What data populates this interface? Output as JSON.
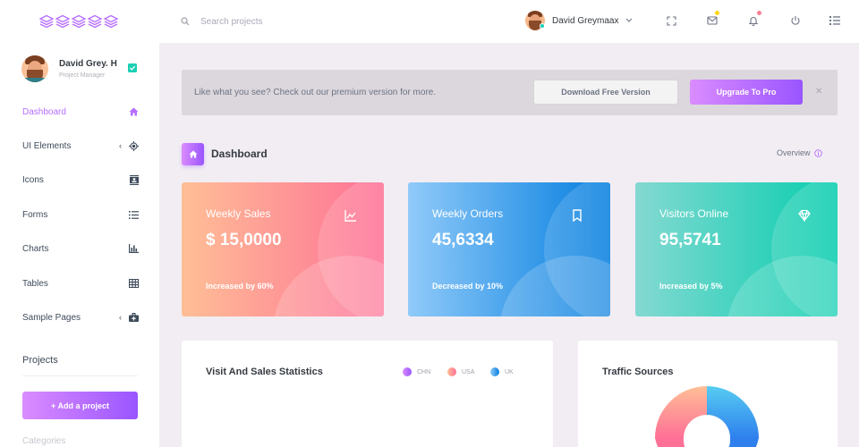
{
  "colors": {
    "accent": "#b66dff",
    "accent_gradient_start": "#da8cff",
    "accent_gradient_end": "#9a55ff",
    "sales_card_start": "#ffbf96",
    "sales_card_end": "#fe7096",
    "orders_card_start": "#90caf9",
    "orders_card_end": "#047edf",
    "visitors_card_start": "#84d9d2",
    "visitors_card_end": "#07cdae",
    "online_dot": "#1bcfb4"
  },
  "topbar": {
    "logo_icon": "stacked-layers-logo",
    "search_icon": "search-icon",
    "search_placeholder": "Search projects",
    "profile_name": "David Greymaax",
    "icons": [
      "fullscreen-icon",
      "mail-icon",
      "bell-icon",
      "power-icon",
      "menu-list-icon"
    ]
  },
  "sidebar": {
    "user": {
      "name": "David Grey. H",
      "role": "Project Manager"
    },
    "items": [
      {
        "label": "Dashboard",
        "icon": "home-icon",
        "chevron": false,
        "active": true
      },
      {
        "label": "UI Elements",
        "icon": "crosshair-icon",
        "chevron": true,
        "active": false
      },
      {
        "label": "Icons",
        "icon": "contacts-icon",
        "chevron": false,
        "active": false
      },
      {
        "label": "Forms",
        "icon": "list-icon",
        "chevron": false,
        "active": false
      },
      {
        "label": "Charts",
        "icon": "bar-chart-icon",
        "chevron": false,
        "active": false
      },
      {
        "label": "Tables",
        "icon": "table-icon",
        "chevron": false,
        "active": false
      },
      {
        "label": "Sample Pages",
        "icon": "medical-bag-icon",
        "chevron": true,
        "active": false
      }
    ],
    "projects_title": "Projects",
    "add_project_label": "+ Add a project",
    "categories_label": "Categories"
  },
  "banner": {
    "text": "Like what you see? Check out our premium version for more.",
    "download_label": "Download Free Version",
    "upgrade_label": "Upgrade To Pro",
    "close_label": "✕"
  },
  "page": {
    "title": "Dashboard",
    "overview_label": "Overview"
  },
  "stats": [
    {
      "title": "Weekly Sales",
      "value": "$ 15,0000",
      "footer": "Increased by 60%",
      "icon": "chart-line-icon"
    },
    {
      "title": "Weekly Orders",
      "value": "45,6334",
      "footer": "Decreased by 10%",
      "icon": "bookmark-icon"
    },
    {
      "title": "Visitors Online",
      "value": "95,5741",
      "footer": "Increased by 5%",
      "icon": "diamond-icon"
    }
  ],
  "visit_panel": {
    "title": "Visit And Sales Statistics",
    "legend": [
      {
        "label": "CHN",
        "color": "#b66dff"
      },
      {
        "label": "USA",
        "color": "#fe7c96"
      },
      {
        "label": "UK",
        "color": "#47a7e8"
      }
    ]
  },
  "traffic_panel": {
    "title": "Traffic Sources"
  }
}
